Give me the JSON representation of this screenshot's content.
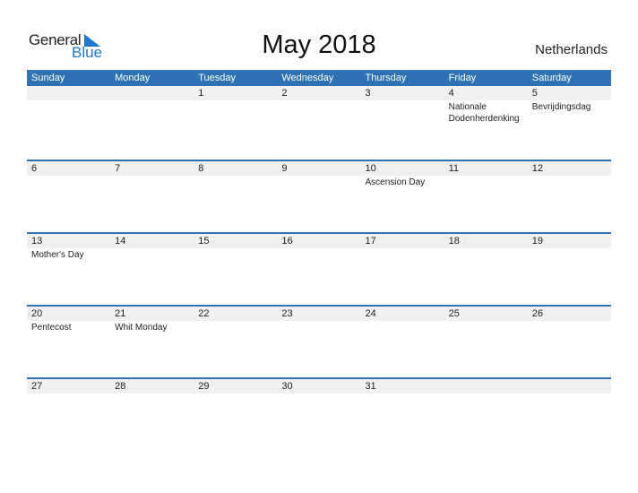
{
  "logo": {
    "word1": "General",
    "word2": "Blue"
  },
  "header": {
    "title": "May 2018",
    "country": "Netherlands"
  },
  "colors": {
    "accent": "#2e72b3",
    "band": "#f0f0f0",
    "logo_blue": "#1f77c9"
  },
  "weekdays": [
    "Sunday",
    "Monday",
    "Tuesday",
    "Wednesday",
    "Thursday",
    "Friday",
    "Saturday"
  ],
  "weeks": [
    {
      "days": [
        "",
        "",
        "1",
        "2",
        "3",
        "4",
        "5"
      ],
      "holidays": [
        "",
        "",
        "",
        "",
        "",
        "Nationale Dodenherdenking",
        "Bevrijdingsdag"
      ]
    },
    {
      "days": [
        "6",
        "7",
        "8",
        "9",
        "10",
        "11",
        "12"
      ],
      "holidays": [
        "",
        "",
        "",
        "",
        "Ascension Day",
        "",
        ""
      ]
    },
    {
      "days": [
        "13",
        "14",
        "15",
        "16",
        "17",
        "18",
        "19"
      ],
      "holidays": [
        "Mother's Day",
        "",
        "",
        "",
        "",
        "",
        ""
      ]
    },
    {
      "days": [
        "20",
        "21",
        "22",
        "23",
        "24",
        "25",
        "26"
      ],
      "holidays": [
        "Pentecost",
        "Whit Monday",
        "",
        "",
        "",
        "",
        ""
      ]
    },
    {
      "days": [
        "27",
        "28",
        "29",
        "30",
        "31",
        "",
        ""
      ],
      "holidays": [
        "",
        "",
        "",
        "",
        "",
        "",
        ""
      ]
    }
  ]
}
